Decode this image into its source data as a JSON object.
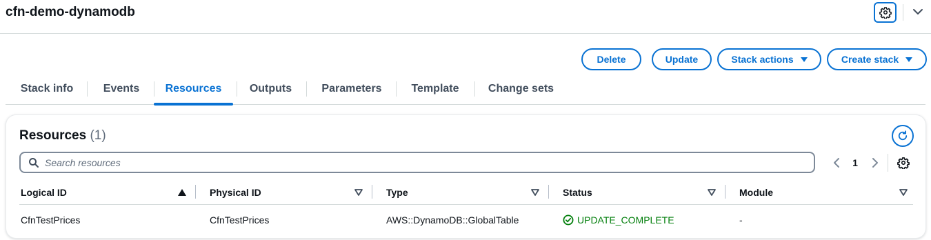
{
  "header": {
    "title": "cfn-demo-dynamodb"
  },
  "actions": {
    "delete": "Delete",
    "update": "Update",
    "stack_actions": "Stack actions",
    "create_stack": "Create stack"
  },
  "tabs": [
    {
      "label": "Stack info",
      "active": false
    },
    {
      "label": "Events",
      "active": false
    },
    {
      "label": "Resources",
      "active": true
    },
    {
      "label": "Outputs",
      "active": false
    },
    {
      "label": "Parameters",
      "active": false
    },
    {
      "label": "Template",
      "active": false
    },
    {
      "label": "Change sets",
      "active": false
    }
  ],
  "resources": {
    "title": "Resources",
    "count": "(1)",
    "search_placeholder": "Search resources",
    "search_value": "",
    "page": "1",
    "columns": [
      {
        "label": "Logical ID",
        "sort": "ascending"
      },
      {
        "label": "Physical ID",
        "sort": "none"
      },
      {
        "label": "Type",
        "sort": "none"
      },
      {
        "label": "Status",
        "sort": "none"
      },
      {
        "label": "Module",
        "sort": "none"
      }
    ],
    "rows": [
      {
        "logical_id": "CfnTestPrices",
        "physical_id": "CfnTestPrices",
        "type": "AWS::DynamoDB::GlobalTable",
        "status": "UPDATE_COMPLETE",
        "module": "-"
      }
    ]
  },
  "colors": {
    "accent": "#0972d3",
    "success": "#037f0c",
    "text": "#0f141a",
    "muted": "#414d5c"
  }
}
